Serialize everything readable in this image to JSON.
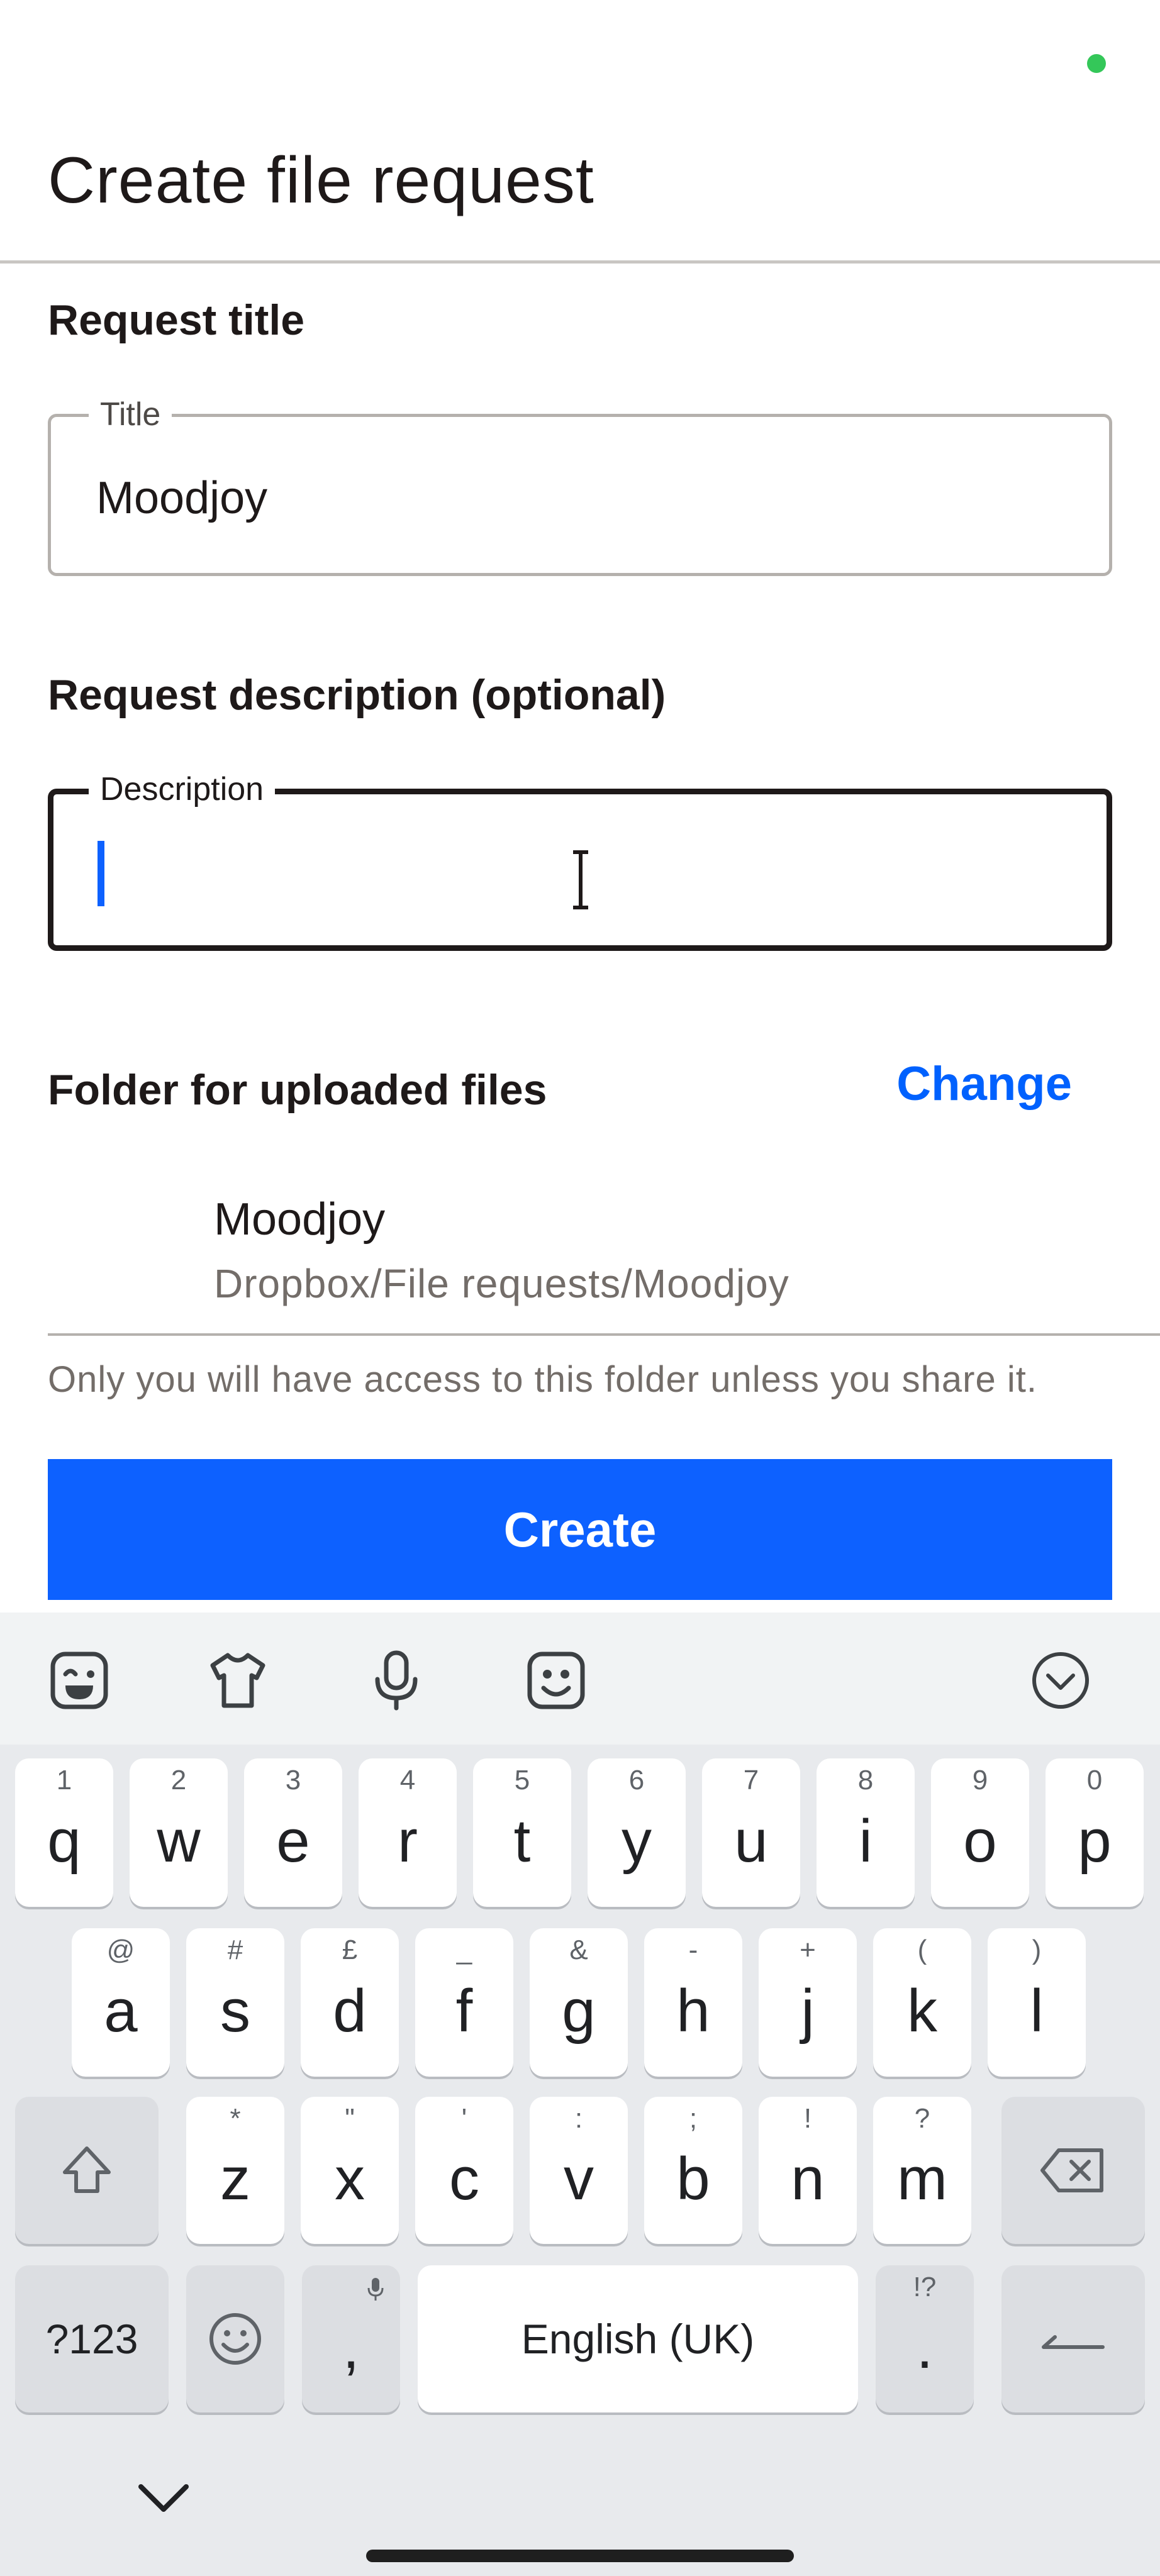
{
  "header": {
    "title": "Create file request"
  },
  "request_title": {
    "section_label": "Request title",
    "field_label": "Title",
    "value": "Moodjoy"
  },
  "request_description": {
    "section_label": "Request description (optional)",
    "field_label": "Description",
    "value": ""
  },
  "folder": {
    "section_label": "Folder for uploaded files",
    "change_label": "Change",
    "name": "Moodjoy",
    "path": "Dropbox/File requests/Moodjoy",
    "note": "Only you will have access to this folder unless you share it."
  },
  "create_button": {
    "label": "Create"
  },
  "colors": {
    "accent": "#0d61ff",
    "link": "#0061fe",
    "status_dot": "#34c759"
  },
  "keyboard": {
    "toolbar_icons": [
      "sticker-icon",
      "shirt-icon",
      "microphone-icon",
      "emoji-icon",
      "collapse-icon"
    ],
    "row1": [
      {
        "key": "q",
        "hint": "1"
      },
      {
        "key": "w",
        "hint": "2"
      },
      {
        "key": "e",
        "hint": "3"
      },
      {
        "key": "r",
        "hint": "4"
      },
      {
        "key": "t",
        "hint": "5"
      },
      {
        "key": "y",
        "hint": "6"
      },
      {
        "key": "u",
        "hint": "7"
      },
      {
        "key": "i",
        "hint": "8"
      },
      {
        "key": "o",
        "hint": "9"
      },
      {
        "key": "p",
        "hint": "0"
      }
    ],
    "row2": [
      {
        "key": "a",
        "hint": "@"
      },
      {
        "key": "s",
        "hint": "#"
      },
      {
        "key": "d",
        "hint": "£"
      },
      {
        "key": "f",
        "hint": "_"
      },
      {
        "key": "g",
        "hint": "&"
      },
      {
        "key": "h",
        "hint": "-"
      },
      {
        "key": "j",
        "hint": "+"
      },
      {
        "key": "k",
        "hint": "("
      },
      {
        "key": "l",
        "hint": ")"
      }
    ],
    "row3": [
      {
        "key": "z",
        "hint": "*"
      },
      {
        "key": "x",
        "hint": "\""
      },
      {
        "key": "c",
        "hint": "'"
      },
      {
        "key": "v",
        "hint": ":"
      },
      {
        "key": "b",
        "hint": ";"
      },
      {
        "key": "n",
        "hint": "!"
      },
      {
        "key": "m",
        "hint": "?"
      }
    ],
    "symbols_label": "?123",
    "comma_label": ",",
    "space_label": "English (UK)",
    "period_label": ".",
    "period_hint": "!?"
  }
}
